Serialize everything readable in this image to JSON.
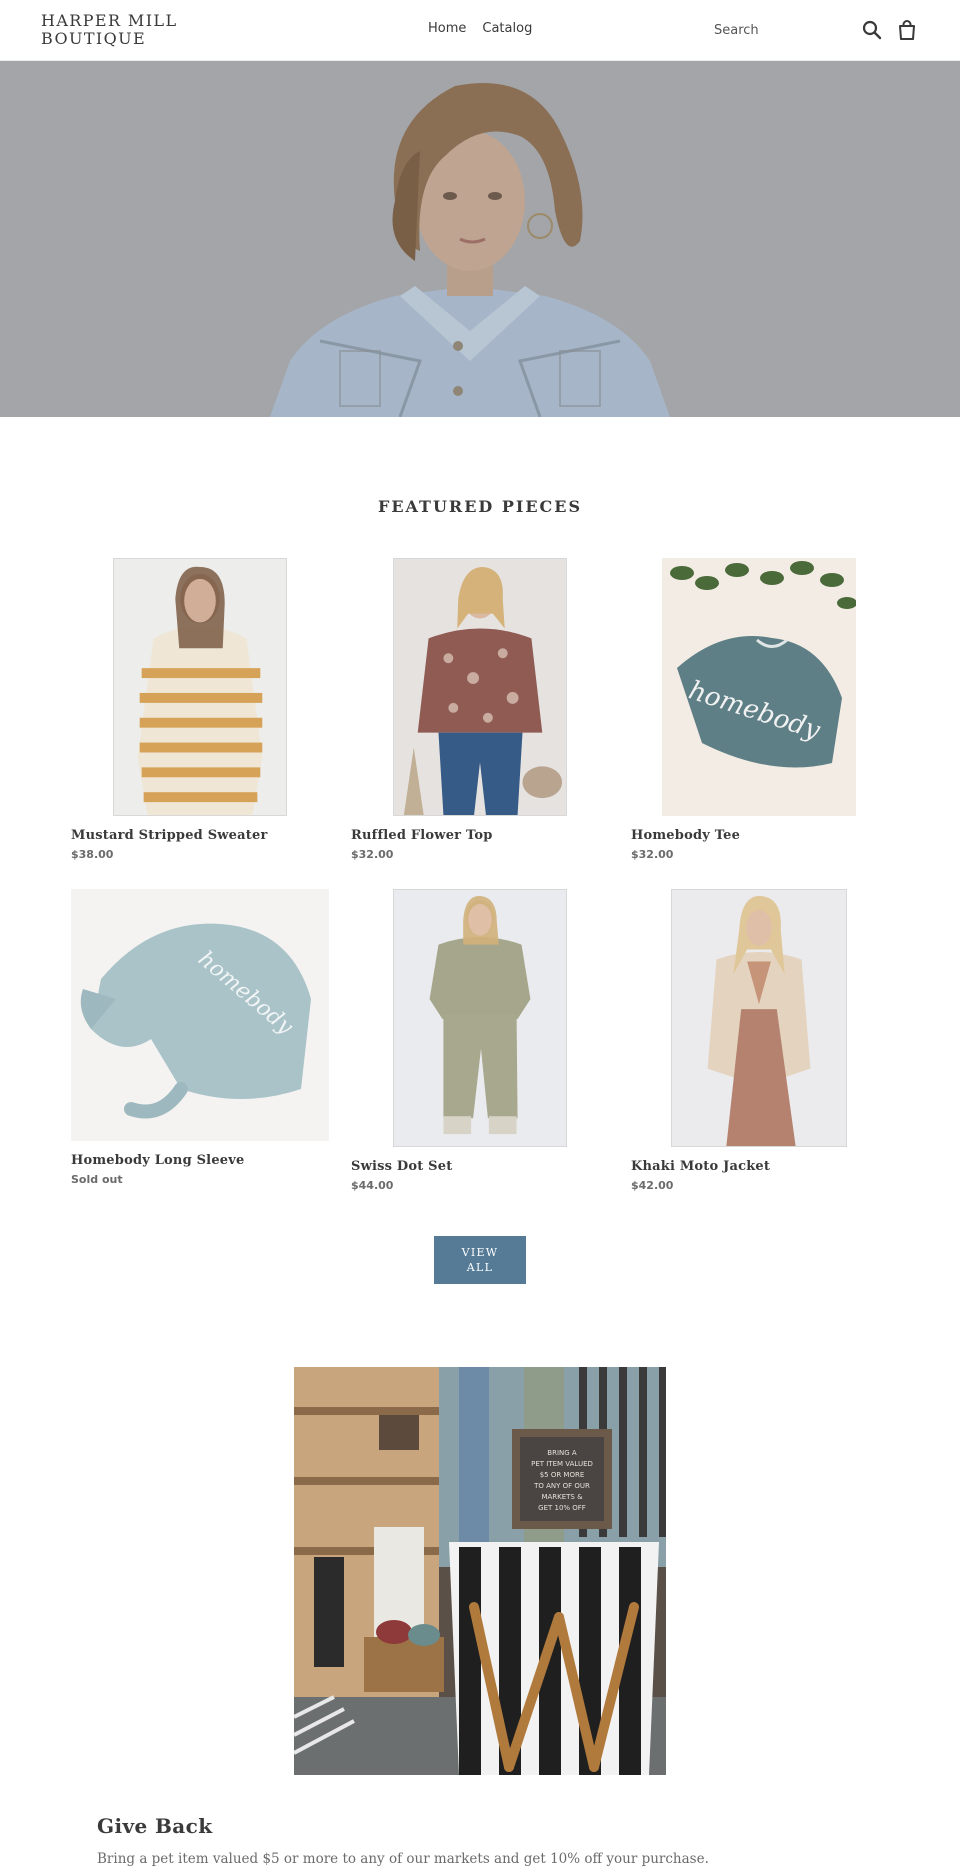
{
  "header": {
    "logo": "HARPER MILL BOUTIQUE",
    "nav": [
      "Home",
      "Catalog"
    ],
    "search_placeholder": "Search",
    "search_icon": "search-icon",
    "cart_icon": "cart-icon"
  },
  "featured": {
    "title": "FEATURED PIECES",
    "products": [
      {
        "title": "Mustard Stripped Sweater",
        "price": "$38.00"
      },
      {
        "title": "Ruffled Flower Top",
        "price": "$32.00"
      },
      {
        "title": "Homebody Tee",
        "price": "$32.00"
      },
      {
        "title": "Homebody Long Sleeve",
        "price": "Sold out"
      },
      {
        "title": "Swiss Dot Set",
        "price": "$44.00"
      },
      {
        "title": "Khaki Moto Jacket",
        "price": "$42.00"
      }
    ],
    "view_all": "VIEW ALL"
  },
  "promo": {
    "sign_lines": [
      "BRING A",
      "PET ITEM VALUED",
      "$5 OR MORE",
      "TO ANY OF OUR",
      "MARKETS &",
      "GET 10% OFF"
    ],
    "title": "Give Back",
    "text": "Bring a pet item valued $5 or more to any of our markets and get 10% off your purchase."
  },
  "colors": {
    "accent": "#557b97",
    "text": "#3a3a3a",
    "muted": "#6b6b6b"
  }
}
